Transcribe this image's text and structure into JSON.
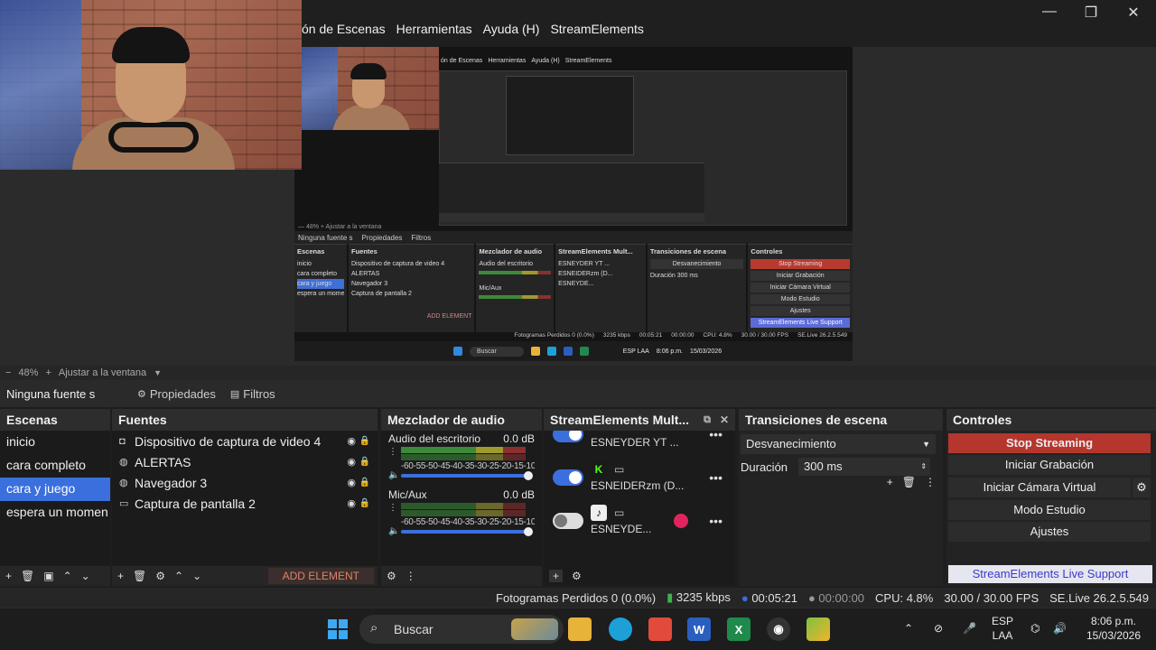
{
  "menu": [
    "ón de Escenas",
    "Herramientas",
    "Ayuda (H)",
    "StreamElements"
  ],
  "window_controls": {
    "minimize": "—",
    "maximize": "❐",
    "close": "✕"
  },
  "preview": {
    "nested_menu": [
      "ón de Escenas",
      "Herramientas",
      "Ayuda (H)",
      "StreamElements"
    ],
    "mini_zoom": "— 48% + Ajustar a la ventana",
    "mini_srcbar": [
      "Ninguna fuente s",
      "Propiedades",
      "Filtros"
    ],
    "mini_docks": {
      "scenes_title": "Escenas",
      "scenes": [
        "inicio",
        "cara completo",
        "cara y juego",
        "espera un momen"
      ],
      "sources_title": "Fuentes",
      "sources": [
        "Dispositivo de captura de video 4",
        "ALERTAS",
        "Navegador 3",
        "Captura de pantalla 2"
      ],
      "mixer_title": "Mezclador de audio",
      "mixer": [
        "Audio del escritorio",
        "Mic/Aux"
      ],
      "se_title": "StreamElements Mult...",
      "se": [
        "ESNEYDER YT ...",
        "ESNEIDERzm (D...",
        "ESNEYDE..."
      ],
      "transitions_title": "Transiciones de escena",
      "transitions": [
        "Desvanecimiento",
        "Duración   300 ms"
      ],
      "controls_title": "Controles",
      "controls": [
        "Stop Streaming",
        "Iniciar Grabación",
        "Iniciar Cámara Virtual",
        "Modo Estudio",
        "Ajustes"
      ],
      "support": "StreamElements Live Support",
      "add_element": "ADD ELEMENT"
    },
    "mini_status": [
      "Fotogramas Perdidos 0 (0.0%)",
      "3235 kbps",
      "00:05:21",
      "00:00:00",
      "CPU: 4.8%",
      "30.00 / 30.00 FPS",
      "SE.Live 26.2.5.549"
    ],
    "mini_taskbar": {
      "search": "Buscar",
      "lang": "ESP LAA",
      "time": "8:06 p.m.",
      "date": "15/03/2026"
    }
  },
  "zoom": {
    "minus": "−",
    "value": "48%",
    "plus": "+",
    "fit": "Ajustar a la ventana"
  },
  "source_toolbar": {
    "no_source": "Ninguna fuente s",
    "properties": "Propiedades",
    "filters": "Filtros"
  },
  "scenes": {
    "title": "Escenas",
    "items": [
      "inicio",
      "cara completo",
      "cara y juego",
      "espera un momen"
    ],
    "selected": "cara y juego"
  },
  "sources": {
    "title": "Fuentes",
    "items": [
      "Dispositivo de captura de video 4",
      "ALERTAS",
      "Navegador 3",
      "Captura de pantalla 2"
    ],
    "add_element": "ADD ELEMENT"
  },
  "mixer": {
    "title": "Mezclador de audio",
    "channels": [
      {
        "name": "Audio del escritorio",
        "db": "0.0 dB"
      },
      {
        "name": "Mic/Aux",
        "db": "0.0 dB"
      }
    ],
    "scale": "-60-55-50-45-40-35-30-25-20-15-10-5 0"
  },
  "streamelements": {
    "title": "StreamElements Mult...",
    "rows": [
      {
        "name": "ESNEYDER YT ...",
        "enabled": true,
        "platform": "youtube"
      },
      {
        "name": "ESNEIDERzm (D...",
        "enabled": true,
        "platform": "kick"
      },
      {
        "name": "ESNEYDE...",
        "enabled": false,
        "platform": "tiktok"
      }
    ],
    "more": "•••"
  },
  "transitions": {
    "title": "Transiciones de escena",
    "selected": "Desvanecimiento",
    "duration_label": "Duración",
    "duration_value": "300 ms"
  },
  "controls": {
    "title": "Controles",
    "stop_streaming": "Stop Streaming",
    "start_recording": "Iniciar Grabación",
    "virtual_cam": "Iniciar Cámara Virtual",
    "studio_mode": "Modo Estudio",
    "settings": "Ajustes",
    "support": "StreamElements Live Support"
  },
  "status": {
    "dropped": "Fotogramas Perdidos 0 (0.0%)",
    "bitrate": "3235 kbps",
    "stream_time": "00:05:21",
    "rec_time": "00:00:00",
    "cpu": "CPU: 4.8%",
    "fps": "30.00 / 30.00 FPS",
    "version": "SE.Live 26.2.5.549"
  },
  "taskbar": {
    "search": "Buscar",
    "lang_top": "ESP",
    "lang_bottom": "LAA",
    "time": "8:06 p.m.",
    "date": "15/03/2026"
  },
  "colors": {
    "accent": "#3b6fde",
    "stop": "#b5362d",
    "background": "#1e1e1e"
  }
}
